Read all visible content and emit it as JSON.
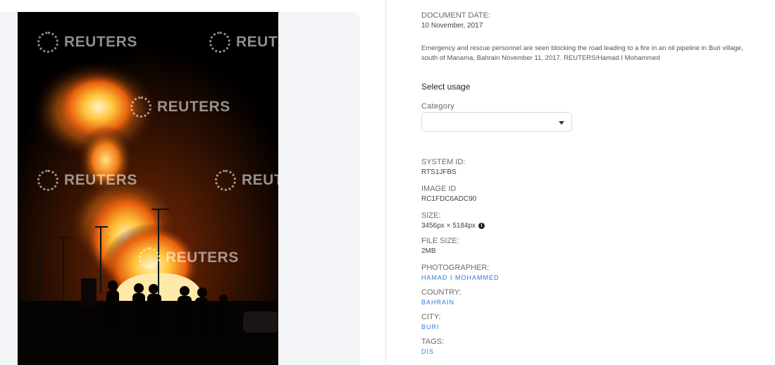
{
  "watermark": "REUTERS",
  "details": {
    "document_date_label": "DOCUMENT DATE:",
    "document_date": "10 November, 2017",
    "caption": "Emergency and rescue personnel are seen blocking the road leading to a fire in an oil pipeline in Buri village, south of Manama, Bahrain November 11, 2017. REUTERS/Hamad I Mohammed",
    "select_usage": "Select usage",
    "category_label": "Category",
    "category_value": "",
    "system_id_label": "SYSTEM ID:",
    "system_id": "RTS1JFBS",
    "image_id_label": "IMAGE ID",
    "image_id": "RC1FDC6ADC90",
    "size_label": "SIZE:",
    "size": "3456px × 5184px",
    "file_size_label": "FILE SIZE:",
    "file_size": "2MB",
    "photographer_label": "PHOTOGRAPHER:",
    "photographer": "HAMAD I MOHAMMED",
    "country_label": "COUNTRY:",
    "country": "BAHRAIN",
    "city_label": "CITY:",
    "city": "BURI",
    "tags_label": "TAGS:",
    "tags": "DIS"
  },
  "icons": {
    "info": "info-icon",
    "caret": "chevron-down-icon",
    "watermark_logo": "reuters-logo-icon"
  },
  "colors": {
    "link": "#2f7ad9",
    "panel_bg": "#f3f4f8",
    "fire_orange": "#ff8a1a"
  }
}
